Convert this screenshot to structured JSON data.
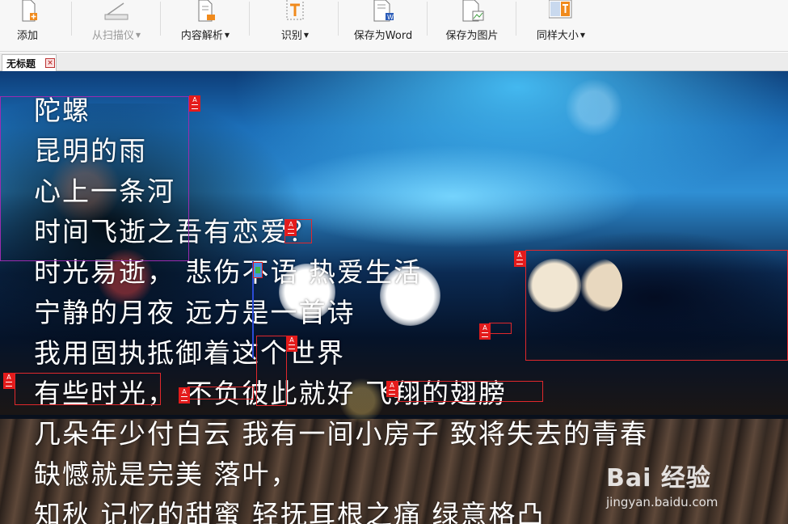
{
  "toolbar": {
    "buttons": [
      {
        "label": "添加",
        "icon": "add-document-icon"
      },
      {
        "label": "从扫描仪",
        "icon": "scanner-icon",
        "disabled": true
      },
      {
        "label": "内容解析",
        "icon": "content-parse-icon"
      },
      {
        "label": "识别",
        "icon": "text-recognize-icon"
      },
      {
        "label": "保存为Word",
        "icon": "save-word-icon"
      },
      {
        "label": "保存为图片",
        "icon": "save-image-icon"
      },
      {
        "label": "同样大小",
        "icon": "same-size-icon"
      }
    ],
    "caret": "▼"
  },
  "tabs": [
    {
      "label": "无标题",
      "close": "×"
    }
  ],
  "poem": {
    "lines": [
      "陀螺",
      "昆明的雨",
      "心上一条河",
      "时间飞逝之吾有恋爱？",
      "时光易逝， 悲伤不语  热爱生活",
      "宁静的月夜  远方是一首诗",
      "我用固执抵御着这个世界",
      "有些时光， 不负彼此就好  飞翔的翅膀",
      "几朵年少付白云  我有一间小房子  致将失去的青春",
      "缺憾就是完美  落叶，",
      "知秋  记忆的甜蜜  轻抚耳根之痛  绿意格凸"
    ]
  },
  "overlay": {
    "text_tag_letter": "A"
  },
  "watermark": {
    "logo": "Bai 经验",
    "url": "jingyan.baidu.com"
  },
  "colors": {
    "region_red": "#e0282c",
    "region_blue": "#2b4bd6",
    "tag_red": "#e41b1b"
  }
}
